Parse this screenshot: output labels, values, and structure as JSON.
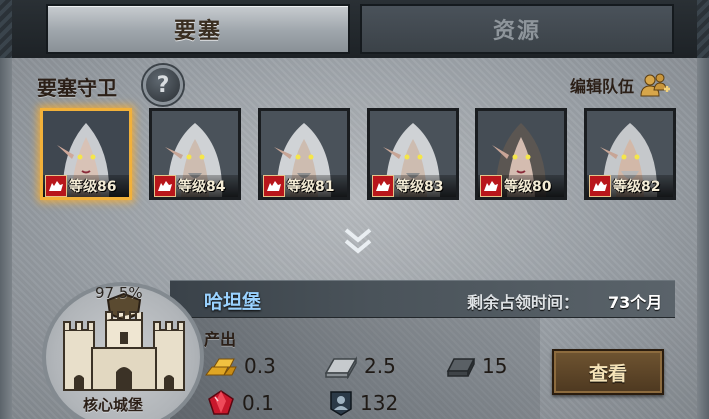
{
  "tabs": [
    {
      "label": "要塞",
      "active": true
    },
    {
      "label": "资源",
      "active": false
    }
  ],
  "guard_section": {
    "title": "要塞守卫",
    "help_icon": "question-mark-icon",
    "help_glyph": "?",
    "edit_team_label": "编辑队伍",
    "edit_team_icon": "add-users-icon"
  },
  "guards": [
    {
      "level_label": "等级86",
      "selected": true,
      "icon": "wolf-emblem-icon"
    },
    {
      "level_label": "等级84",
      "selected": false,
      "icon": "wolf-emblem-icon"
    },
    {
      "level_label": "等级81",
      "selected": false,
      "icon": "wolf-emblem-icon"
    },
    {
      "level_label": "等级83",
      "selected": false,
      "icon": "wolf-emblem-icon"
    },
    {
      "level_label": "等级80",
      "selected": false,
      "icon": "wolf-emblem-icon"
    },
    {
      "level_label": "等级82",
      "selected": false,
      "icon": "wolf-emblem-icon"
    }
  ],
  "expand_icon": "double-chevron-down-icon",
  "castle": {
    "percent": "97.5%",
    "type_name": "核心城堡",
    "name": "哈坦堡",
    "remaining_label": "剩余占领时间：",
    "remaining_value": "73个月"
  },
  "production": {
    "label": "产出",
    "resources": [
      {
        "icon": "gold-bars-icon",
        "value": "0.3"
      },
      {
        "icon": "iron-ingot-icon",
        "value": "2.5"
      },
      {
        "icon": "stone-block-icon",
        "value": "15"
      },
      {
        "icon": "ruby-gem-icon",
        "value": "0.1"
      },
      {
        "icon": "troop-badge-icon",
        "value": "132"
      }
    ]
  },
  "view_button_label": "查看",
  "colors": {
    "tab_active_text": "#3a2e21",
    "castle_name": "#9ad2ff",
    "selected_glow": "#f2b13a",
    "wolf_badge": "#b8161b",
    "button_bg": "#5e4629"
  }
}
